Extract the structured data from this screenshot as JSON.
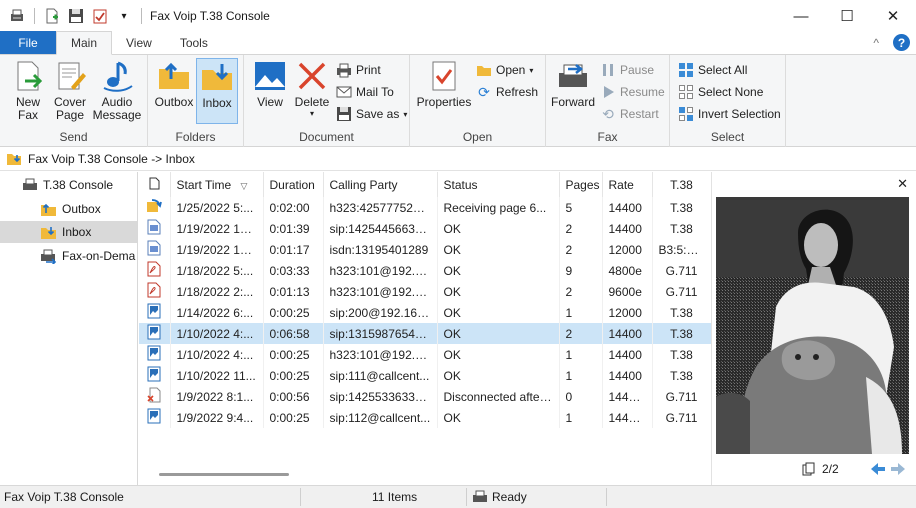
{
  "window": {
    "title": "Fax Voip T.38 Console",
    "minimize": "—",
    "maximize": "☐",
    "close": "✕"
  },
  "tabs": {
    "file": "File",
    "main": "Main",
    "view": "View",
    "tools": "Tools",
    "collapse": "^",
    "help": "?"
  },
  "ribbon": {
    "send": {
      "label": "Send",
      "new_fax": "New Fax",
      "cover_page": "Cover Page",
      "audio_message": "Audio Message"
    },
    "folders": {
      "label": "Folders",
      "outbox": "Outbox",
      "inbox": "Inbox"
    },
    "document": {
      "label": "Document",
      "view": "View",
      "delete": "Delete",
      "print": "Print",
      "mail_to": "Mail To",
      "save_as": "Save as"
    },
    "open": {
      "label": "Open",
      "properties": "Properties",
      "open": "Open",
      "refresh": "Refresh"
    },
    "fax": {
      "label": "Fax",
      "forward": "Forward",
      "pause": "Pause",
      "resume": "Resume",
      "restart": "Restart"
    },
    "select": {
      "label": "Select",
      "select_all": "Select All",
      "select_none": "Select None",
      "invert_selection": "Invert Selection"
    }
  },
  "address": {
    "path": "Fax Voip T.38 Console -> Inbox"
  },
  "tree": {
    "root": "T.38 Console",
    "outbox": "Outbox",
    "inbox": "Inbox",
    "fax_on_demand": "Fax-on-Dema"
  },
  "table": {
    "columns": [
      "Start Time",
      "Duration",
      "Calling Party",
      "Status",
      "Pages",
      "Rate",
      "T.38"
    ],
    "sort_indicator": "▽",
    "rows": [
      {
        "icon": "receiving",
        "start": "1/25/2022 5:...",
        "duration": "0:02:00",
        "caller": "h323:4257775222...",
        "status": "Receiving page 6...",
        "pages": "5",
        "rate": "14400",
        "t38": "T.38"
      },
      {
        "icon": "image",
        "start": "1/19/2022 12...",
        "duration": "0:01:39",
        "caller": "sip:14254456633...",
        "status": "OK",
        "pages": "2",
        "rate": "14400",
        "t38": "T.38"
      },
      {
        "icon": "image",
        "start": "1/19/2022 12...",
        "duration": "0:01:17",
        "caller": "isdn:13195401289",
        "status": "OK",
        "pages": "2",
        "rate": "12000",
        "t38": "B3:5:SFF"
      },
      {
        "icon": "pdf",
        "start": "1/18/2022 5:...",
        "duration": "0:03:33",
        "caller": "h323:101@192.16...",
        "status": "OK",
        "pages": "9",
        "rate": "4800e",
        "t38": "G.711"
      },
      {
        "icon": "pdf",
        "start": "1/18/2022 2:...",
        "duration": "0:01:13",
        "caller": "h323:101@192.16...",
        "status": "OK",
        "pages": "2",
        "rate": "9600e",
        "t38": "G.711"
      },
      {
        "icon": "photo",
        "start": "1/14/2022 6:...",
        "duration": "0:00:25",
        "caller": "sip:200@192.168....",
        "status": "OK",
        "pages": "1",
        "rate": "12000",
        "t38": "T.38"
      },
      {
        "icon": "photo",
        "start": "1/10/2022 4:...",
        "duration": "0:06:58",
        "caller": "sip:13159876543...",
        "status": "OK",
        "pages": "2",
        "rate": "14400",
        "t38": "T.38",
        "selected": true
      },
      {
        "icon": "photo",
        "start": "1/10/2022 4:...",
        "duration": "0:00:25",
        "caller": "h323:101@192.16...",
        "status": "OK",
        "pages": "1",
        "rate": "14400",
        "t38": "T.38"
      },
      {
        "icon": "photo",
        "start": "1/10/2022 11...",
        "duration": "0:00:25",
        "caller": "sip:111@callcent...",
        "status": "OK",
        "pages": "1",
        "rate": "14400",
        "t38": "T.38"
      },
      {
        "icon": "failed",
        "start": "1/9/2022 8:1...",
        "duration": "0:00:56",
        "caller": "sip:14255336330...",
        "status": "Disconnected after...",
        "pages": "0",
        "rate": "14400e",
        "t38": "G.711"
      },
      {
        "icon": "photo",
        "start": "1/9/2022 9:4...",
        "duration": "0:00:25",
        "caller": "sip:112@callcent...",
        "status": "OK",
        "pages": "1",
        "rate": "14400e",
        "t38": "G.711"
      }
    ]
  },
  "preview": {
    "close": "✕",
    "page_indicator": "2/2"
  },
  "status": {
    "app": "Fax Voip T.38 Console",
    "items": "11 Items",
    "state": "Ready"
  },
  "colors": {
    "accent": "#1f6fc5",
    "selection": "#cce4f7",
    "ribbon_bg": "#f5f6f7"
  }
}
